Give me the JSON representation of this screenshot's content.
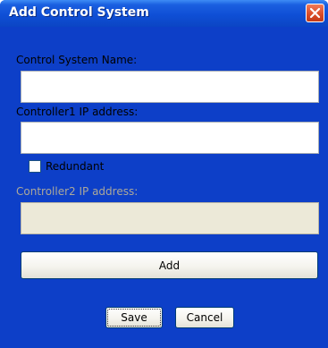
{
  "window": {
    "title": "Add Control System"
  },
  "form": {
    "name_label": "Control System Name:",
    "name_value": "",
    "ip1_label": "Controller1 IP address:",
    "ip1_value": "",
    "redundant_label": "Redundant",
    "redundant_checked": false,
    "ip2_label": "Controller2 IP address:",
    "ip2_value": "",
    "ip2_enabled": false
  },
  "buttons": {
    "add_label": "Add",
    "save_label": "Save",
    "cancel_label": "Cancel"
  },
  "icons": {
    "close": "close-icon"
  },
  "colors": {
    "titlebar": "#0f4fd6",
    "close": "#d94a25",
    "dialog_bg": "#ece9d8"
  }
}
